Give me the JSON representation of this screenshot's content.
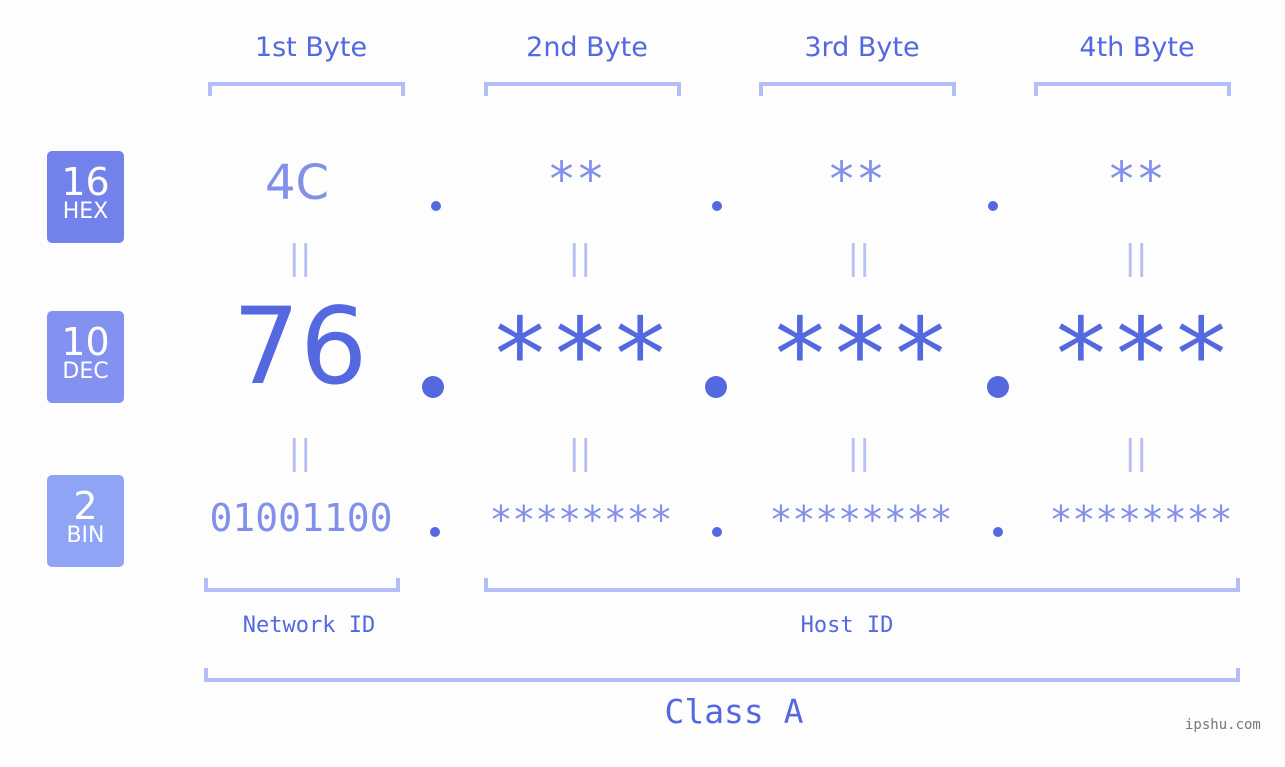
{
  "bytes": [
    {
      "header": "1st Byte",
      "hex": "4C",
      "dec": "76",
      "bin": "01001100"
    },
    {
      "header": "2nd Byte",
      "hex": "**",
      "dec": "***",
      "bin": "********"
    },
    {
      "header": "3rd Byte",
      "hex": "**",
      "dec": "***",
      "bin": "********"
    },
    {
      "header": "4th Byte",
      "hex": "**",
      "dec": "***",
      "bin": "********"
    }
  ],
  "bases": [
    {
      "number": "16",
      "label": "HEX",
      "color": "#7381ea"
    },
    {
      "number": "10",
      "label": "DEC",
      "color": "#8391f0"
    },
    {
      "number": "2",
      "label": "BIN",
      "color": "#8fa4f5"
    }
  ],
  "equals_symbol": "||",
  "segments": {
    "network": "Network ID",
    "host": "Host ID"
  },
  "ip_class": "Class A",
  "watermark": "ipshu.com",
  "colors": {
    "primary": "#5468e0",
    "secondary": "#8390ea",
    "bracket": "#b3bdf7"
  }
}
